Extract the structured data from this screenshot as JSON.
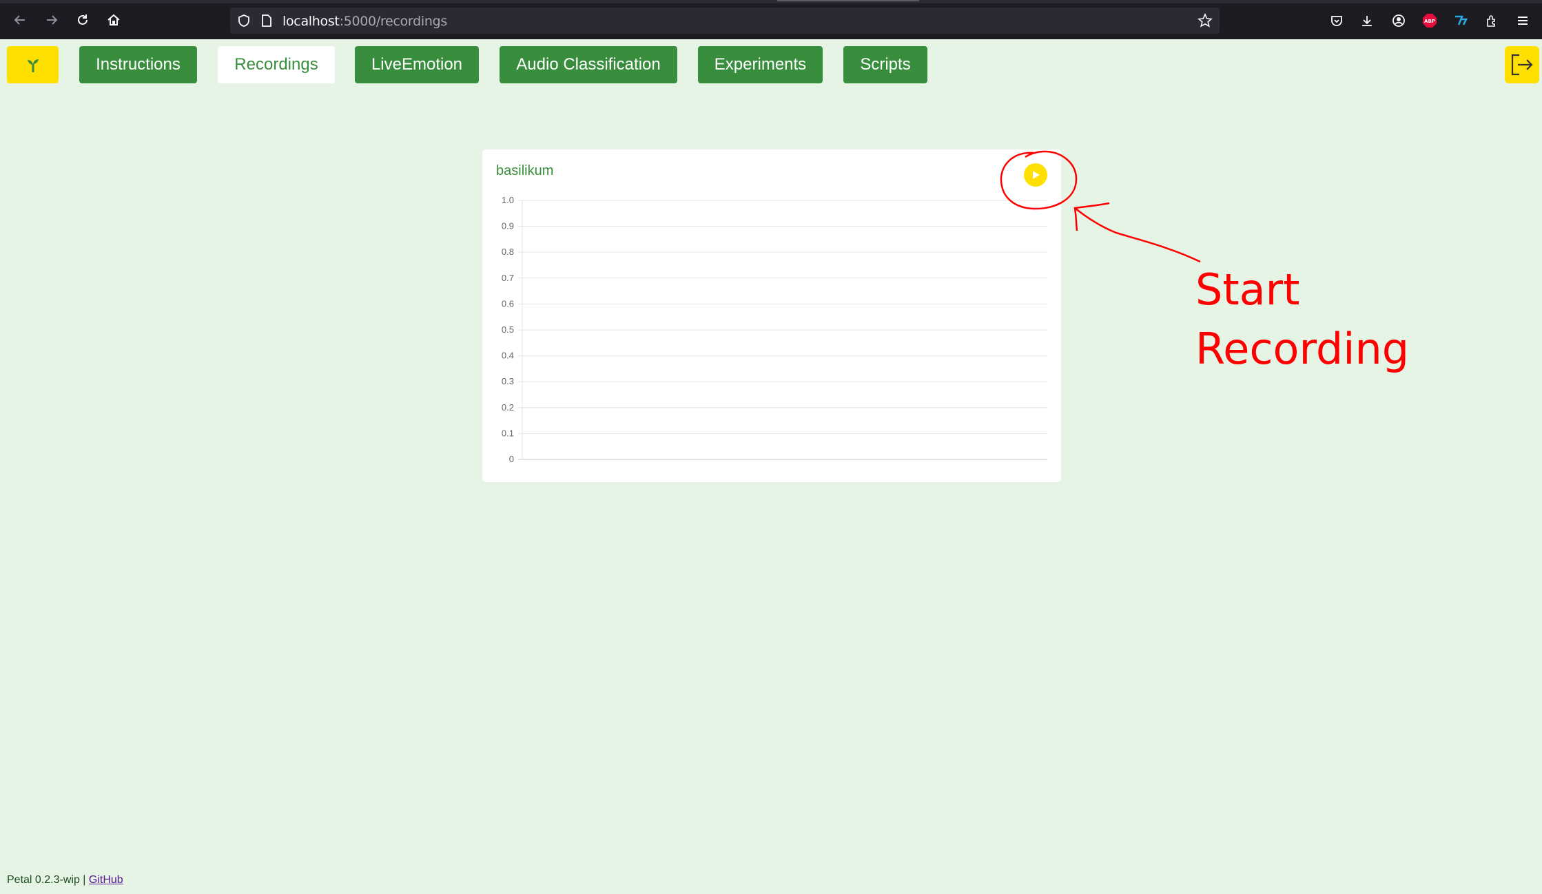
{
  "browser": {
    "url_host": "localhost",
    "url_path": ":5000/recordings"
  },
  "nav": {
    "tabs": [
      {
        "label": "Instructions",
        "active": false
      },
      {
        "label": "Recordings",
        "active": true
      },
      {
        "label": "LiveEmotion",
        "active": false
      },
      {
        "label": "Audio Classification",
        "active": false
      },
      {
        "label": "Experiments",
        "active": false
      },
      {
        "label": "Scripts",
        "active": false
      }
    ]
  },
  "card": {
    "title": "basilikum"
  },
  "chart_data": {
    "type": "line",
    "series": [],
    "y_ticks": [
      "1.0",
      "0.9",
      "0.8",
      "0.7",
      "0.6",
      "0.5",
      "0.4",
      "0.3",
      "0.2",
      "0.1",
      "0"
    ],
    "ylim": [
      0,
      1.0
    ],
    "grid": true
  },
  "annotation": {
    "line1": "Start",
    "line2": "Recording"
  },
  "footer": {
    "version": "Petal 0.2.3-wip |",
    "link": "GitHub"
  },
  "colors": {
    "primary": "#388e3c",
    "accent": "#ffdf00",
    "background": "#e6f4e6",
    "annotation": "#ff0000"
  }
}
